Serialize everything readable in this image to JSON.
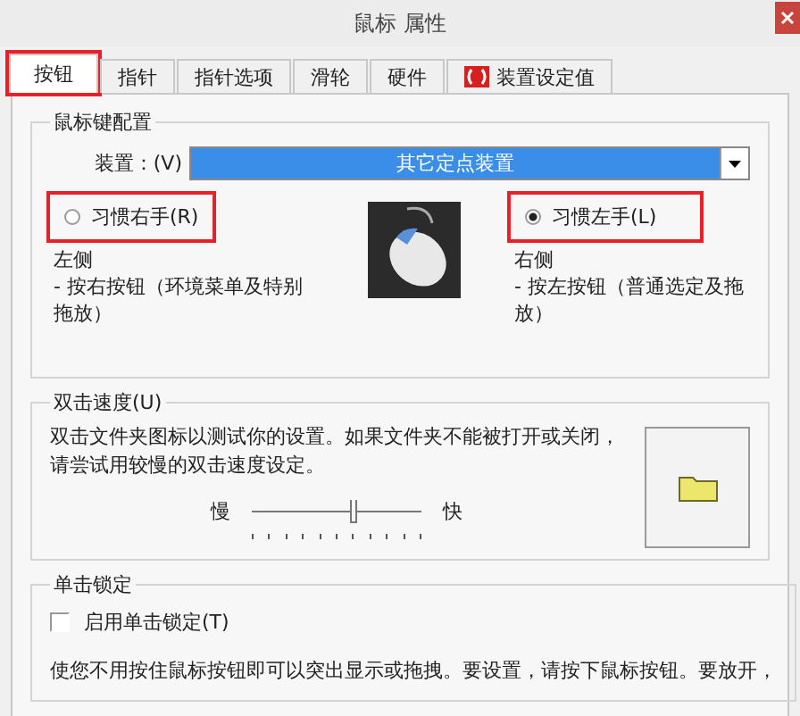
{
  "window": {
    "title": "鼠标 属性"
  },
  "tabs": [
    {
      "label": "按钮",
      "selected": true,
      "highlighted": true,
      "kind": "text"
    },
    {
      "label": "指针",
      "selected": false,
      "highlighted": false,
      "kind": "text"
    },
    {
      "label": "指针选项",
      "selected": false,
      "highlighted": false,
      "kind": "text"
    },
    {
      "label": "滑轮",
      "selected": false,
      "highlighted": false,
      "kind": "text"
    },
    {
      "label": "硬件",
      "selected": false,
      "highlighted": false,
      "kind": "text"
    },
    {
      "label": "装置设定值",
      "selected": false,
      "highlighted": false,
      "kind": "device"
    }
  ],
  "button_config": {
    "title": "鼠标键配置",
    "device_label": "装置：(V)",
    "device_value": "其它定点装置",
    "options": [
      {
        "label": "习惯右手(R)",
        "selected": false,
        "highlighted": true,
        "side": "左侧",
        "description": "- 按右按钮（环境菜单及特别拖放）"
      },
      {
        "label": "习惯左手(L)",
        "selected": true,
        "highlighted": true,
        "side": "右侧",
        "description": "- 按左按钮（普通选定及拖放）"
      }
    ]
  },
  "double_click": {
    "title": "双击速度(U)",
    "description": "双击文件夹图标以测试你的设置。如果文件夹不能被打开或关闭，请尝试用较慢的双击速度设定。",
    "slow_label": "慢",
    "fast_label": "快",
    "level": 0.6
  },
  "click_lock": {
    "title": "单击锁定",
    "checkbox_label": "启用单击锁定(T)",
    "checked": false,
    "description": "使您不用按住鼠标按钮即可以突出显示或拖拽。要设置，请按下鼠标按钮。要放开，"
  }
}
